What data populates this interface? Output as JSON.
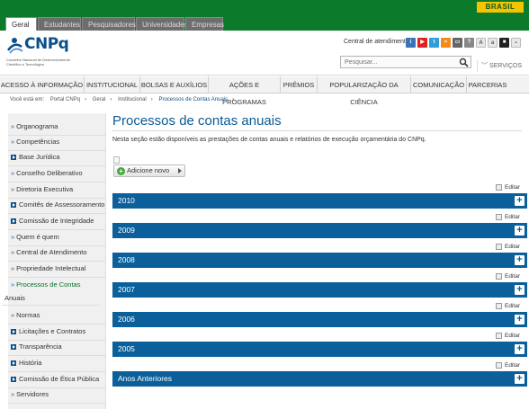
{
  "gov_bar": {
    "brasil_label": "BRASIL"
  },
  "audience_tabs": [
    {
      "label": "Geral",
      "active": true
    },
    {
      "label": "Estudantes",
      "active": false
    },
    {
      "label": "Pesquisadores",
      "active": false
    },
    {
      "label": "Universidades",
      "active": false
    },
    {
      "label": "Empresas",
      "active": false
    }
  ],
  "header": {
    "logo_text": "CNPq",
    "logo_sub": "Conselho Nacional de Desenvolvimento Científico e Tecnológico",
    "central_label": "Central de atendimento",
    "search_placeholder": "Pesquisar...",
    "servicos_label": "SERVIÇOS",
    "colors": {
      "brand_blue": "#0b4f8a",
      "gov_green": "#0b7a2b",
      "gov_yellow": "#f5c400"
    }
  },
  "main_nav": [
    "ACESSO À INFORMAÇÃO",
    "INSTITUCIONAL",
    "BOLSAS E AUXÍLIOS",
    "AÇÕES E PROGRAMAS",
    "PRÊMIOS",
    "POPULARIZAÇÃO DA CIÊNCIA",
    "COMUNICAÇÃO",
    "PARCERIAS"
  ],
  "breadcrumb": {
    "prefix": "Você está em:",
    "items": [
      "Portal CNPq",
      "Geral",
      "Institucional"
    ],
    "current": "Processos de Contas Anuais"
  },
  "sidebar": [
    {
      "label": "Organograma",
      "kind": "bullet"
    },
    {
      "label": "Competências",
      "kind": "bullet"
    },
    {
      "label": "Base Jurídica",
      "kind": "box"
    },
    {
      "label": "Conselho Deliberativo",
      "kind": "bullet"
    },
    {
      "label": "Diretoria Executiva",
      "kind": "bullet"
    },
    {
      "label": "Comitês de Assessoramento",
      "kind": "box"
    },
    {
      "label": "Comissão de Integridade",
      "kind": "box"
    },
    {
      "label": "Quem é quem",
      "kind": "bullet"
    },
    {
      "label": "Central de Atendimento",
      "kind": "bullet"
    },
    {
      "label": "Propriedade Intelectual",
      "kind": "bullet"
    },
    {
      "label": "Processos de Contas",
      "kind": "bullet",
      "active": true
    },
    {
      "label": "Anuais",
      "kind": "sub",
      "active": true
    },
    {
      "label": "Normas",
      "kind": "bullet"
    },
    {
      "label": "Licitações e Contratos",
      "kind": "box"
    },
    {
      "label": "Transparência",
      "kind": "box"
    },
    {
      "label": "História",
      "kind": "box"
    },
    {
      "label": "Comissão de Ética Pública",
      "kind": "box"
    },
    {
      "label": "Servidores",
      "kind": "bullet"
    }
  ],
  "content": {
    "title": "Processos de contas anuais",
    "intro": "Nesta seção estão disponíveis as prestações de contas anuais e relatórios de execução orçamentária do CNPq.",
    "add_button": "Adicione novo",
    "edit_label": "Editar",
    "sections": [
      "2010",
      "2009",
      "2008",
      "2007",
      "2006",
      "2005",
      "Anos Anteriores"
    ],
    "expand_symbol": "+"
  }
}
